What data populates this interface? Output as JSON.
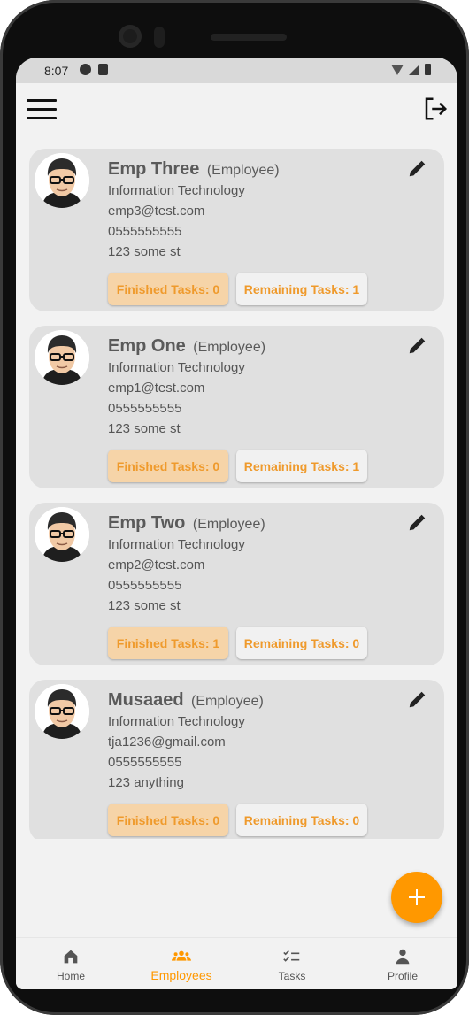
{
  "status_bar": {
    "time": "8:07"
  },
  "employees": [
    {
      "name": "Emp Three",
      "role": "(Employee)",
      "department": "Information Technology",
      "email": "emp3@test.com",
      "phone": "0555555555",
      "address": "123 some st",
      "finished": "Finished Tasks: 0",
      "remaining": "Remaining Tasks: 1"
    },
    {
      "name": "Emp One",
      "role": "(Employee)",
      "department": "Information Technology",
      "email": "emp1@test.com",
      "phone": "0555555555",
      "address": "123 some st",
      "finished": "Finished Tasks: 0",
      "remaining": "Remaining Tasks: 1"
    },
    {
      "name": "Emp Two",
      "role": "(Employee)",
      "department": "Information Technology",
      "email": "emp2@test.com",
      "phone": "0555555555",
      "address": "123 some st",
      "finished": "Finished Tasks: 1",
      "remaining": "Remaining Tasks: 0"
    },
    {
      "name": "Musaaed",
      "role": "(Employee)",
      "department": "Information Technology",
      "email": "tja1236@gmail.com",
      "phone": "0555555555",
      "address": "123 anything",
      "finished": "Finished Tasks: 0",
      "remaining": "Remaining Tasks: 0"
    }
  ],
  "bottom_nav": [
    {
      "label": "Home",
      "icon": "home-icon"
    },
    {
      "label": "Employees",
      "icon": "people-icon",
      "active": true
    },
    {
      "label": "Tasks",
      "icon": "tasks-icon"
    },
    {
      "label": "Profile",
      "icon": "person-icon"
    }
  ],
  "colors": {
    "accent": "#ff9800",
    "chip_finished_bg": "#f6d4a8",
    "chip_text": "#ef9a2c",
    "card_bg": "#e0e0e0"
  }
}
